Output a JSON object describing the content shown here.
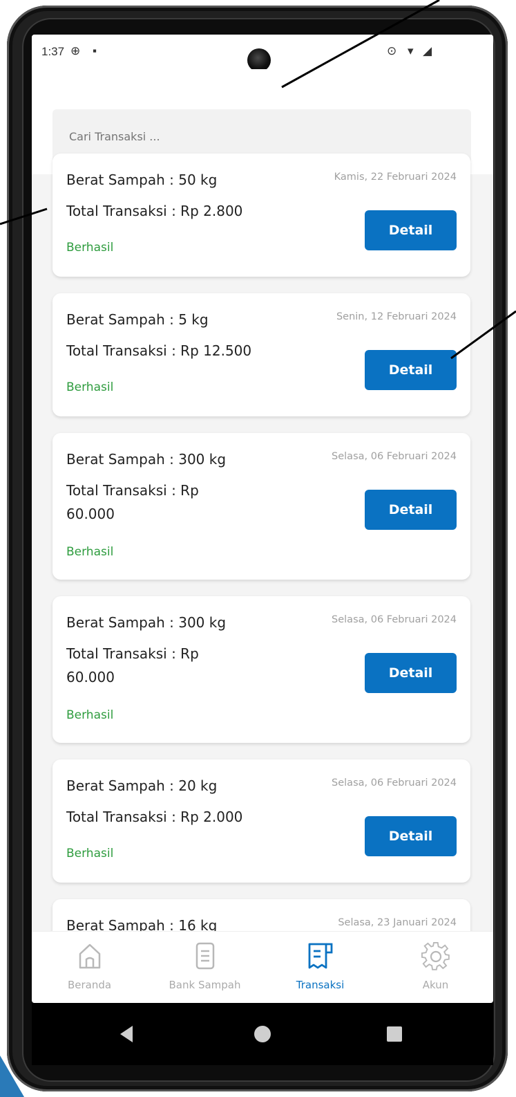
{
  "status_bar": {
    "time": "1:37"
  },
  "search": {
    "placeholder": "Cari Transaksi ..."
  },
  "transactions": [
    {
      "weight": "Berat Sampah : 50 kg",
      "total": "Total Transaksi : Rp 2.800",
      "date": "Kamis, 22 Februari 2024",
      "status": "Berhasil",
      "button": "Detail"
    },
    {
      "weight": "Berat Sampah : 5 kg",
      "total": "Total Transaksi : Rp 12.500",
      "date": "Senin, 12 Februari 2024",
      "status": "Berhasil",
      "button": "Detail"
    },
    {
      "weight": "Berat Sampah : 300 kg",
      "total": "Total Transaksi : Rp 60.000",
      "date": "Selasa, 06 Februari 2024",
      "status": "Berhasil",
      "button": "Detail"
    },
    {
      "weight": "Berat Sampah : 300 kg",
      "total": "Total Transaksi : Rp 60.000",
      "date": "Selasa, 06 Februari 2024",
      "status": "Berhasil",
      "button": "Detail"
    },
    {
      "weight": "Berat Sampah : 20 kg",
      "total": "Total Transaksi : Rp 2.000",
      "date": "Selasa, 06 Februari 2024",
      "status": "Berhasil",
      "button": "Detail"
    },
    {
      "weight": "Berat Sampah : 16 kg",
      "date": "Selasa, 23 Januari 2024"
    }
  ],
  "bottom_nav": [
    {
      "label": "Beranda",
      "icon": "home-icon",
      "active": false
    },
    {
      "label": "Bank Sampah",
      "icon": "document-icon",
      "active": false
    },
    {
      "label": "Transaksi",
      "icon": "receipt-icon",
      "active": true
    },
    {
      "label": "Akun",
      "icon": "gear-icon",
      "active": false
    }
  ],
  "colors": {
    "primary": "#0a72c2",
    "success": "#2e9c3e",
    "muted": "#a0a0a0"
  }
}
